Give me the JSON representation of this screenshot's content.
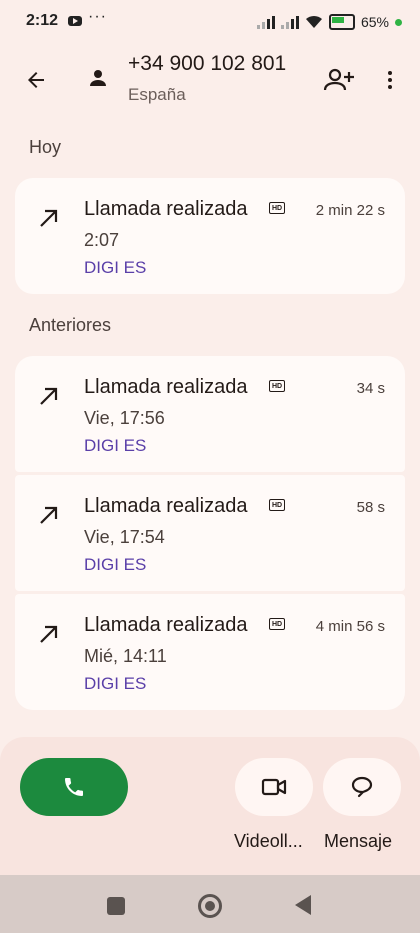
{
  "status_bar": {
    "time": "2:12",
    "dots": "···",
    "battery": "65%",
    "accent_green": "#2fb344"
  },
  "header": {
    "phone_number": "+34 900 102 801",
    "country": "España",
    "icons": {
      "back": "arrow-left-icon",
      "contact": "person-icon",
      "add_contact": "person-add-icon",
      "more": "more-vert-icon"
    }
  },
  "sections": {
    "today": "Hoy",
    "earlier": "Anteriores"
  },
  "calls_today": [
    {
      "type": "Llamada realizada",
      "hd": "HD",
      "duration": "2 min 22 s",
      "time": "2:07",
      "carrier": "DIGI ES"
    }
  ],
  "calls_earlier": [
    {
      "type": "Llamada realizada",
      "hd": "HD",
      "duration": "34 s",
      "time": "Vie, 17:56",
      "carrier": "DIGI ES"
    },
    {
      "type": "Llamada realizada",
      "hd": "HD",
      "duration": "58 s",
      "time": "Vie, 17:54",
      "carrier": "DIGI ES"
    },
    {
      "type": "Llamada realizada",
      "hd": "HD",
      "duration": "4 min 56 s",
      "time": "Mié, 14:11",
      "carrier": "DIGI ES"
    }
  ],
  "actions": {
    "call_icon": "phone-icon",
    "video_label": "Videoll...",
    "video_icon": "videocam-icon",
    "message_label": "Mensaje",
    "message_icon": "chat-bubble-icon",
    "call_color": "#1c8a3e"
  },
  "colors": {
    "background": "#fbeeea",
    "card": "#fffaf8",
    "carrier_text": "#5a3fa8"
  }
}
